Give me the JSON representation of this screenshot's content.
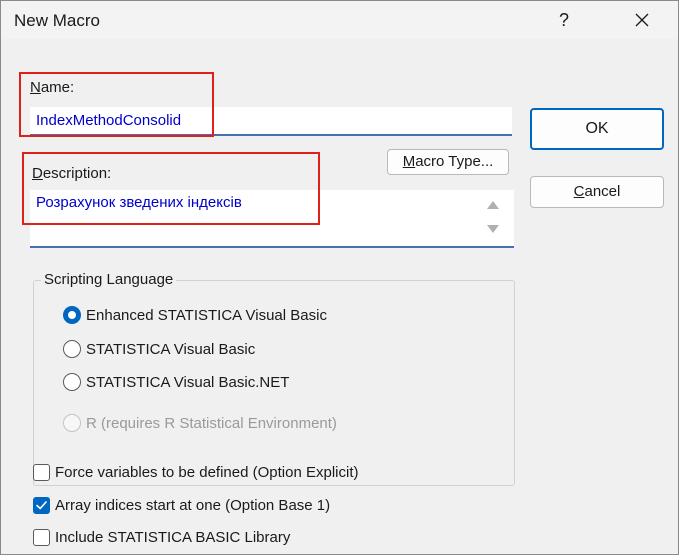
{
  "window": {
    "title": "New Macro",
    "help_glyph": "?"
  },
  "name_field": {
    "label_mnemonic": "N",
    "label_rest": "ame:",
    "value": "IndexMethodConsolid"
  },
  "description_field": {
    "label_mnemonic": "D",
    "label_rest": "escription:",
    "value": "Розрахунок зведених індексів"
  },
  "buttons": {
    "ok": "OK",
    "cancel_mnemonic": "C",
    "cancel_rest": "ancel",
    "macro_type_mnemonic": "M",
    "macro_type_rest": "acro Type..."
  },
  "scripting_language": {
    "title": "Scripting Language",
    "options": [
      {
        "label": "Enhanced STATISTICA Visual Basic",
        "checked": true,
        "enabled": true
      },
      {
        "label": "STATISTICA Visual Basic",
        "checked": false,
        "enabled": true
      },
      {
        "label": "STATISTICA Visual Basic.NET",
        "checked": false,
        "enabled": true
      },
      {
        "label": "R  (requires R Statistical Environment)",
        "checked": false,
        "enabled": false
      }
    ]
  },
  "checkboxes": [
    {
      "label": "Force variables to be defined (Option Explicit)",
      "checked": false
    },
    {
      "label": "Array indices start at one (Option Base 1)",
      "checked": true
    },
    {
      "label": "Include STATISTICA BASIC Library",
      "checked": false
    }
  ],
  "colors": {
    "accent": "#0067c0",
    "highlight_box": "#e0201b",
    "input_text": "#0000cc"
  },
  "icons": {
    "close": "close-icon",
    "scroll_up": "scroll-up-icon",
    "scroll_down": "scroll-down-icon",
    "checkmark": "checkmark-icon"
  }
}
